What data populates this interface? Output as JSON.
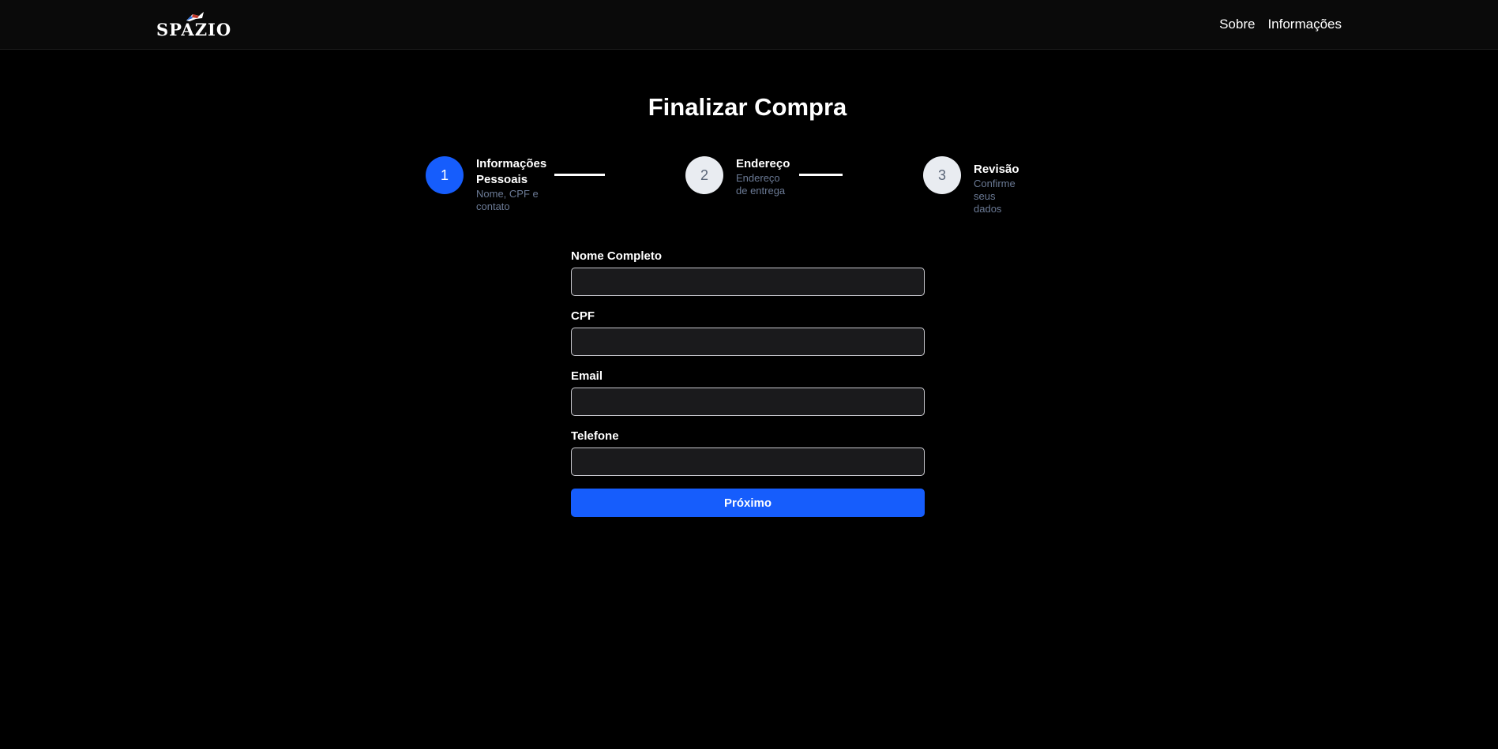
{
  "header": {
    "logo_text": "SPAZIO",
    "nav": [
      {
        "label": "Sobre"
      },
      {
        "label": "Informações"
      }
    ]
  },
  "page": {
    "title": "Finalizar Compra"
  },
  "steps": [
    {
      "number": "1",
      "title_line1": "Informações",
      "title_line2": "Pessoais",
      "sub_line1": "Nome, CPF e",
      "sub_line2": "contato",
      "state": "active"
    },
    {
      "number": "2",
      "title_line1": "Endereço",
      "title_line2": "",
      "sub_line1": "Endereço",
      "sub_line2": "de entrega",
      "state": "inactive"
    },
    {
      "number": "3",
      "title_line1": "Revisão",
      "title_line2": "",
      "sub_line1": "Confirme seus dados",
      "sub_line2": "",
      "state": "inactive"
    }
  ],
  "form": {
    "fields": [
      {
        "label": "Nome Completo",
        "value": "",
        "placeholder": ""
      },
      {
        "label": "CPF",
        "value": "",
        "placeholder": ""
      },
      {
        "label": "Email",
        "value": "",
        "placeholder": ""
      },
      {
        "label": "Telefone",
        "value": "",
        "placeholder": ""
      }
    ],
    "submit_label": "Próximo"
  },
  "colors": {
    "accent": "#165dfc",
    "background": "#000000",
    "navbar": "#0a0a0a",
    "input_bg": "#1a1a1c",
    "muted_text": "#6b7a95",
    "inactive_step": "#e9ecf1"
  }
}
